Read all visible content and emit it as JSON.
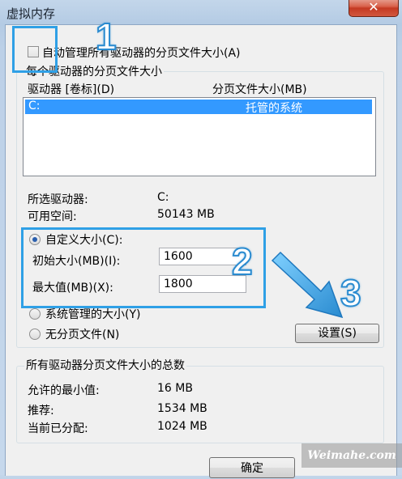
{
  "window": {
    "title": "虚拟内存",
    "close_glyph": "✕"
  },
  "auto_manage": {
    "label": "自动管理所有驱动器的分页文件大小(A)",
    "checked": false
  },
  "paging_group": {
    "title": "每个驱动器的分页文件大小",
    "list_headers": {
      "drive": "驱动器 [卷标](D)",
      "size": "分页文件大小(MB)"
    },
    "list_rows": [
      {
        "drive": "C:",
        "size": "托管的系统"
      }
    ],
    "selected_drive_label": "所选驱动器:",
    "selected_drive_value": "C:",
    "free_space_label": "可用空间:",
    "free_space_value": "50143 MB",
    "custom_size": {
      "label": "自定义大小(C):",
      "selected": true
    },
    "initial_size": {
      "label": "初始大小(MB)(I):",
      "value": "1600"
    },
    "max_size": {
      "label": "最大值(MB)(X):",
      "value": "1800"
    },
    "system_managed": {
      "label": "系统管理的大小(Y)",
      "selected": false
    },
    "no_paging": {
      "label": "无分页文件(N)",
      "selected": false
    },
    "set_button": "设置(S)"
  },
  "total_group": {
    "title": "所有驱动器分页文件大小的总数",
    "min_label": "允许的最小值:",
    "min_value": "16 MB",
    "recommended_label": "推荐:",
    "recommended_value": "1534 MB",
    "current_label": "当前已分配:",
    "current_value": "1024 MB"
  },
  "ok_button": "确定",
  "annotations": {
    "num1": "1",
    "num2": "2",
    "num3": "3",
    "color": "#2fa0e6"
  },
  "watermark": "Weimahe.com"
}
